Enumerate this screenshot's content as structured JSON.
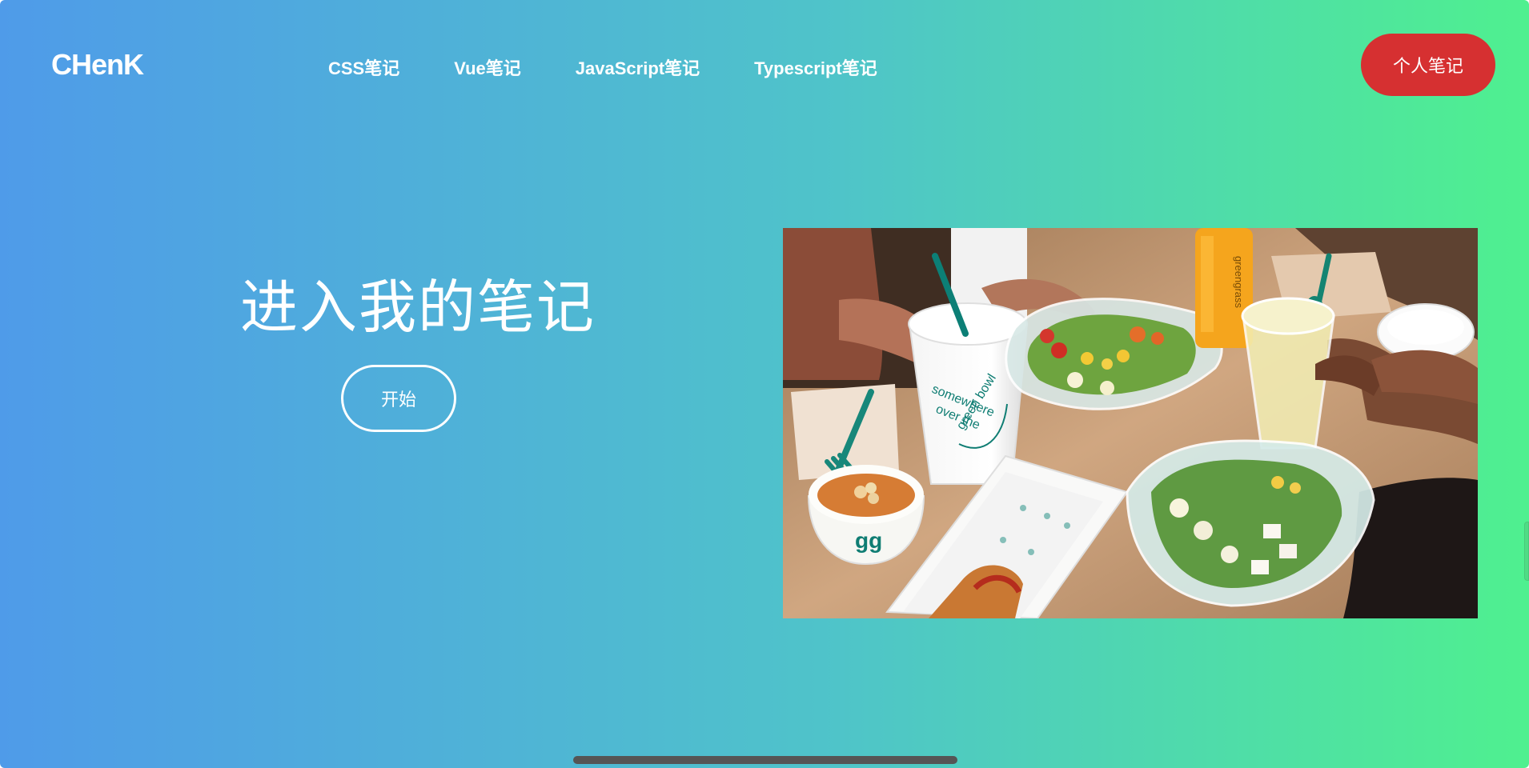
{
  "header": {
    "brand": "CHenK",
    "nav": [
      {
        "label": "CSS笔记"
      },
      {
        "label": "Vue笔记"
      },
      {
        "label": "JavaScript笔记"
      },
      {
        "label": "Typescript笔记"
      }
    ],
    "cta_label": "个人笔记"
  },
  "hero": {
    "title": "进入我的笔记",
    "button_label": "开始",
    "image": {
      "semantic": "food-photo-salads-soup-sandwich-drinks",
      "cup_text_1": "somewhere",
      "cup_text_2": "over the",
      "cup_text_3": "green bowl",
      "bottle_text": "greengrass",
      "bowl_text": "gg"
    }
  },
  "colors": {
    "gradient_left": "#4f9be9",
    "gradient_mid": "#4fc4c9",
    "gradient_right": "#4ff08f",
    "cta_bg": "#d63031",
    "text": "#ffffff"
  }
}
